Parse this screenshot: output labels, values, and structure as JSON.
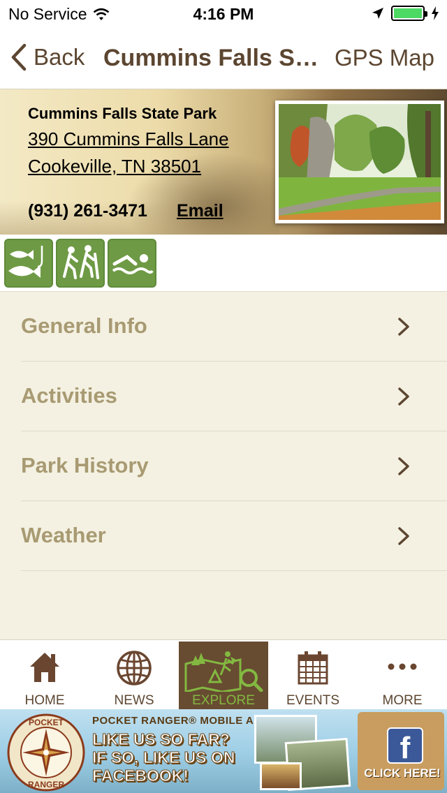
{
  "status_bar": {
    "carrier": "No Service",
    "time": "4:16 PM"
  },
  "nav": {
    "back_label": "Back",
    "title": "Cummins Falls State Park",
    "right_label": "GPS Map"
  },
  "park": {
    "name": "Cummins Falls State Park",
    "address_line1": "390 Cummins Falls Lane",
    "address_line2": "Cookeville, TN 38501",
    "phone": "(931) 261-3471",
    "email_label": "Email"
  },
  "amenities": [
    {
      "icon": "fishing-icon"
    },
    {
      "icon": "hiking-icon"
    },
    {
      "icon": "swimming-icon"
    }
  ],
  "menu": [
    {
      "label": "General Info"
    },
    {
      "label": "Activities"
    },
    {
      "label": "Park History"
    },
    {
      "label": "Weather"
    }
  ],
  "tabs": [
    {
      "label": "HOME",
      "icon": "home-icon",
      "active": false
    },
    {
      "label": "NEWS",
      "icon": "globe-icon",
      "active": false
    },
    {
      "label": "EXPLORE",
      "icon": "map-icon",
      "active": true
    },
    {
      "label": "EVENTS",
      "icon": "calendar-icon",
      "active": false
    },
    {
      "label": "MORE",
      "icon": "more-icon",
      "active": false
    }
  ],
  "ad": {
    "logo_text_top": "POCKET",
    "logo_text_bottom": "RANGER",
    "top_line": "POCKET RANGER® MOBILE APPS",
    "line1": "LIKE US SO FAR?",
    "line2": "IF SO, LIKE US ON",
    "line3": "FACEBOOK!",
    "cta": "CLICK HERE!"
  },
  "colors": {
    "brand_brown": "#5c4631",
    "accent_green": "#6e9a45",
    "menu_text": "#a89a72",
    "background": "#f4f1e2"
  }
}
